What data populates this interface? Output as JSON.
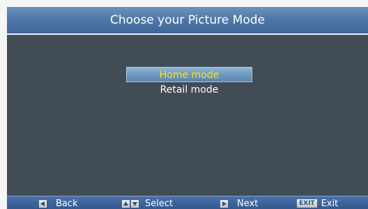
{
  "header": {
    "title": "Choose your Picture Mode"
  },
  "menu": {
    "items": [
      {
        "label": "Home mode",
        "selected": true
      },
      {
        "label": "Retail mode",
        "selected": false
      }
    ],
    "selected_color": "#ffe800"
  },
  "footer": {
    "back_label": "Back",
    "select_label": "Select",
    "next_label": "Next",
    "exit_key": "EXIT",
    "exit_label": "Exit",
    "icons": [
      "left-arrow-icon",
      "up-arrow-icon",
      "down-arrow-icon",
      "right-arrow-icon"
    ]
  },
  "colors": {
    "background": "#424c54",
    "header": "#4f78a8",
    "footer": "#3e6499"
  }
}
